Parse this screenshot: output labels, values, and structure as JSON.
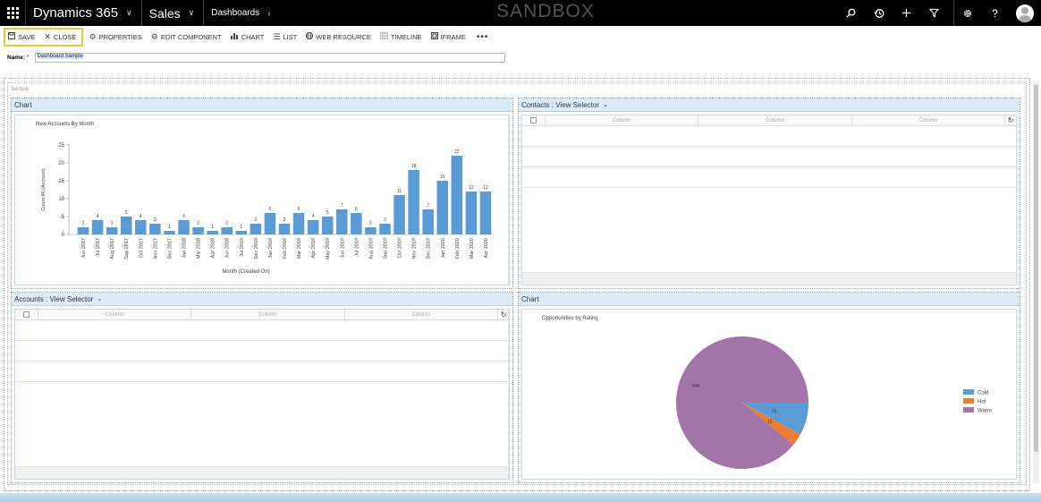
{
  "nav": {
    "brand": "Dynamics 365",
    "area": "Sales",
    "breadcrumb": "Dashboards",
    "environment": "SANDBOX",
    "icons": [
      "search-icon",
      "recent-icon",
      "plus-icon",
      "filter-icon",
      "gear-icon",
      "help-icon",
      "user-avatar"
    ]
  },
  "commands": {
    "save": "SAVE",
    "close": "CLOSE",
    "properties": "PROPERTIES",
    "edit_component": "EDIT COMPONENT",
    "chart": "CHART",
    "list": "LIST",
    "web_resource": "WEB RESOURCE",
    "timeline": "TIMELINE",
    "iframe": "IFRAME",
    "more": "•••"
  },
  "form": {
    "name_label": "Name:",
    "required_mark": "*",
    "name_value": "Dashboard Sample"
  },
  "section": {
    "label": "Section"
  },
  "panels": {
    "accounts_chart": {
      "header": "Chart"
    },
    "contacts": {
      "header": "Contacts : View Selector",
      "columns": [
        "Column",
        "Column",
        "Column"
      ]
    },
    "accounts": {
      "header": "Accounts : View Selector",
      "columns": [
        "Column",
        "Column",
        "Column"
      ]
    },
    "rating_chart": {
      "header": "Chart"
    }
  },
  "chart_data": [
    {
      "type": "bar",
      "title": "New Accounts By Month",
      "xlabel": "Month (Created On)",
      "ylabel": "Count:All (Account)",
      "ylim": [
        0,
        25
      ],
      "yticks": [
        0,
        5,
        10,
        15,
        20,
        25
      ],
      "color": "#5b9bd5",
      "categories": [
        "Jun 2017",
        "Jul 2017",
        "Aug 2017",
        "Sep 2017",
        "Oct 2017",
        "Nov 2017",
        "Dec 2017",
        "Jan 2018",
        "Mar 2018",
        "Apr 2018",
        "Jun 2018",
        "Jul 2018",
        "Dec 2018",
        "Jan 2019",
        "Feb 2019",
        "Mar 2019",
        "Apr 2019",
        "May 2019",
        "Jun 2019",
        "Jul 2019",
        "Aug 2019",
        "Sep 2019",
        "Oct 2019",
        "Nov 2019",
        "Dec 2019",
        "Jan 2020",
        "Feb 2020",
        "Mar 2020",
        "Apr 2020"
      ],
      "values": [
        2,
        4,
        2,
        5,
        4,
        3,
        1,
        4,
        2,
        1,
        2,
        1,
        3,
        6,
        3,
        6,
        4,
        5,
        7,
        6,
        2,
        3,
        11,
        18,
        7,
        15,
        22,
        12,
        12
      ],
      "grid": false
    },
    {
      "type": "pie",
      "title": "Opportunities by Rating",
      "legend_position": "right",
      "slices": [
        {
          "name": "Cold",
          "value": 31,
          "color": "#5b9bd5"
        },
        {
          "name": "Hot",
          "value": 12,
          "color": "#ed7d31"
        },
        {
          "name": "Warm",
          "value": 348,
          "color": "#a374a8"
        }
      ]
    }
  ]
}
